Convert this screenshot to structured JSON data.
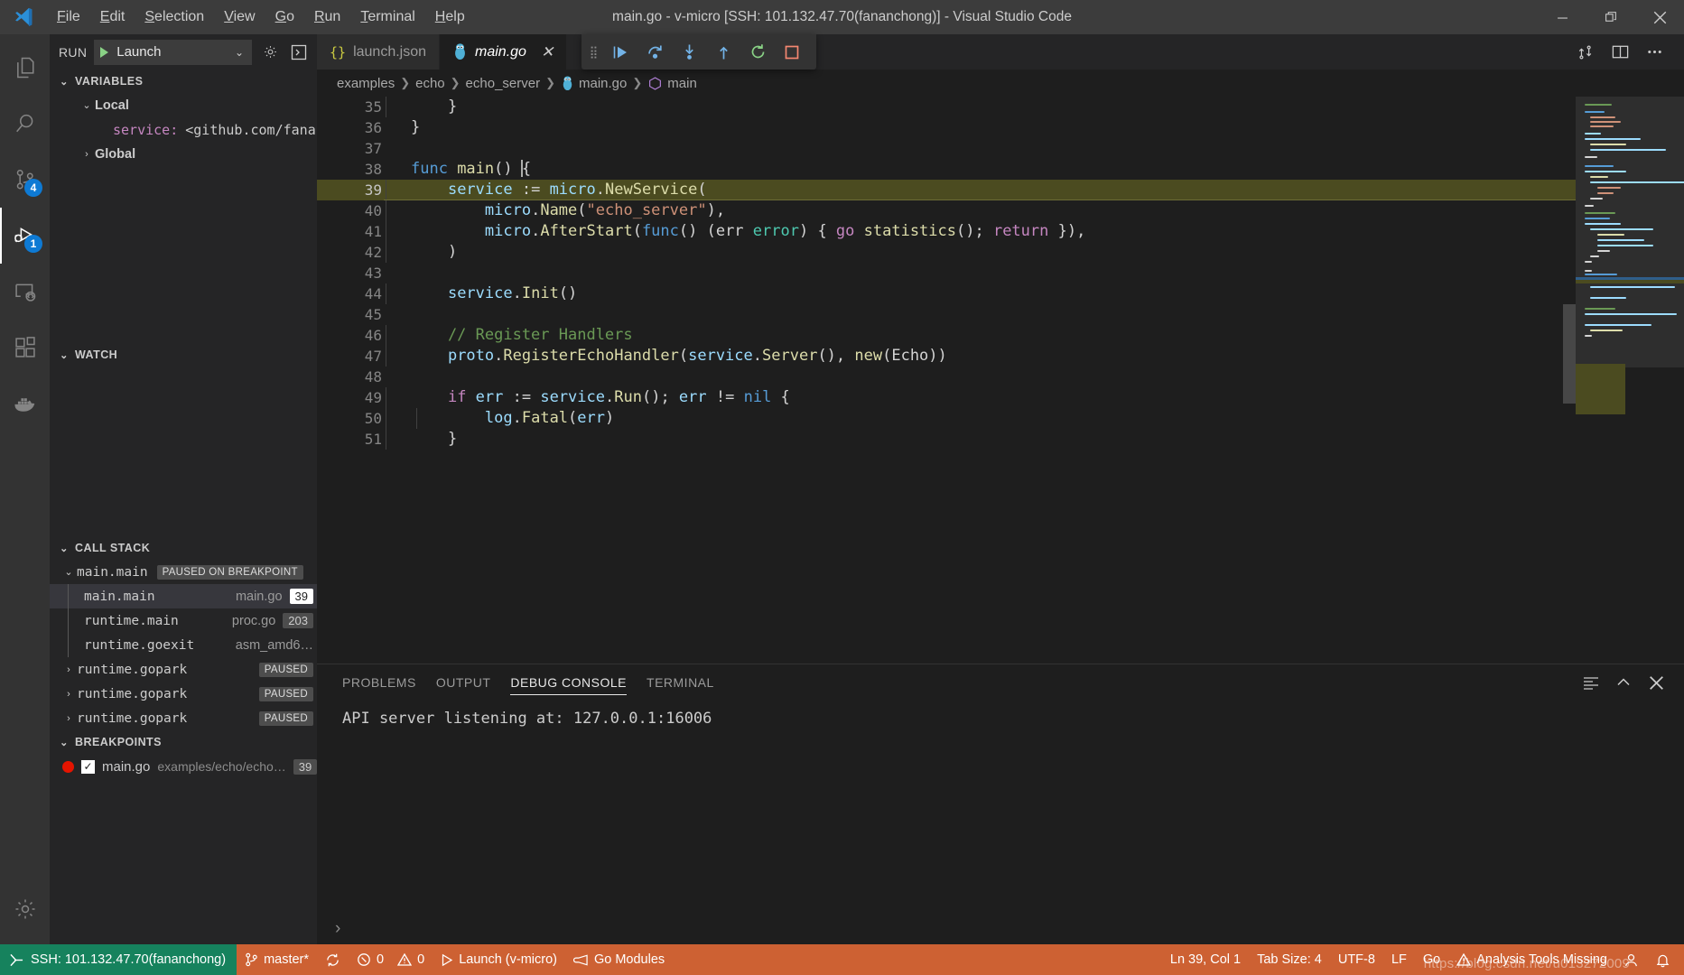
{
  "window": {
    "title": "main.go - v-micro [SSH: 101.132.47.70(fananchong)] - Visual Studio Code",
    "minimize_label": "Minimize",
    "restore_label": "Restore",
    "close_label": "Close"
  },
  "menubar": {
    "items": [
      {
        "label": "File"
      },
      {
        "label": "Edit"
      },
      {
        "label": "Selection"
      },
      {
        "label": "View"
      },
      {
        "label": "Go"
      },
      {
        "label": "Run"
      },
      {
        "label": "Terminal"
      },
      {
        "label": "Help"
      }
    ]
  },
  "activitybar": {
    "items": [
      {
        "name": "explorer",
        "icon": "files-icon",
        "badge": ""
      },
      {
        "name": "search",
        "icon": "search-icon",
        "badge": ""
      },
      {
        "name": "source-control",
        "icon": "source-control-icon",
        "badge": "4"
      },
      {
        "name": "run-and-debug",
        "icon": "run-debug-icon",
        "badge": "1",
        "active": true
      },
      {
        "name": "remote-explorer",
        "icon": "remote-explorer-icon",
        "badge": ""
      },
      {
        "name": "extensions",
        "icon": "extensions-icon",
        "badge": ""
      },
      {
        "name": "docker",
        "icon": "docker-icon",
        "badge": ""
      }
    ],
    "bottom": [
      {
        "name": "manage",
        "icon": "gear-icon"
      }
    ]
  },
  "sidebar": {
    "run_label": "RUN",
    "launch_config": "Launch",
    "settings_icon_label": "Open launch.json",
    "open_debug_console_label": "Debug Console",
    "variables": {
      "header": "VARIABLES",
      "rows": [
        {
          "indent": 0,
          "twisty": "down",
          "label": "Local",
          "bold": true
        },
        {
          "indent": 1,
          "twisty": "none",
          "name": "service:",
          "value": "<github.com/fananc…",
          "mono": true
        },
        {
          "indent": 0,
          "twisty": "right",
          "label": "Global",
          "bold": true
        }
      ]
    },
    "watch": {
      "header": "WATCH",
      "rows": []
    },
    "callstack": {
      "header": "CALL STACK",
      "threads": [
        {
          "name": "main.main",
          "badge": "PAUSED ON BREAKPOINT",
          "expanded": true,
          "frames": [
            {
              "name": "main.main",
              "file": "main.go",
              "line": "39",
              "selected": true
            },
            {
              "name": "runtime.main",
              "file": "proc.go",
              "line": "203",
              "selected": false
            },
            {
              "name": "runtime.goexit",
              "file": "asm_amd6…",
              "line": "",
              "selected": false
            }
          ]
        },
        {
          "name": "runtime.gopark",
          "badge": "PAUSED",
          "expanded": false,
          "frames": []
        },
        {
          "name": "runtime.gopark",
          "badge": "PAUSED",
          "expanded": false,
          "frames": []
        },
        {
          "name": "runtime.gopark",
          "badge": "PAUSED",
          "expanded": false,
          "frames": []
        }
      ]
    },
    "breakpoints": {
      "header": "BREAKPOINTS",
      "rows": [
        {
          "file": "main.go",
          "path": "examples/echo/echo…",
          "line": "39",
          "enabled": true
        }
      ]
    }
  },
  "editor": {
    "tabs": [
      {
        "label": "launch.json",
        "icon": "json-icon",
        "active": false,
        "closable": false
      },
      {
        "label": "main.go",
        "icon": "go-gopher-icon",
        "active": true,
        "closable": true,
        "close_label": "×"
      }
    ],
    "actions": [
      {
        "name": "run-or-debug",
        "icon": "split-source-control-icon"
      },
      {
        "name": "split-editor",
        "icon": "split-editor-icon"
      },
      {
        "name": "more-actions",
        "icon": "ellipsis-icon"
      }
    ],
    "debug_toolbar": [
      {
        "name": "continue",
        "icon": "continue-icon"
      },
      {
        "name": "step-over",
        "icon": "step-over-icon"
      },
      {
        "name": "step-into",
        "icon": "step-into-icon"
      },
      {
        "name": "step-out",
        "icon": "step-out-icon"
      },
      {
        "name": "restart",
        "icon": "restart-icon"
      },
      {
        "name": "stop",
        "icon": "stop-icon"
      }
    ],
    "breadcrumbs": [
      {
        "label": "examples",
        "icon": ""
      },
      {
        "label": "echo",
        "icon": ""
      },
      {
        "label": "echo_server",
        "icon": ""
      },
      {
        "label": "main.go",
        "icon": "go-gopher-icon"
      },
      {
        "label": "main",
        "icon": "symbol-method-icon"
      }
    ],
    "lines": [
      {
        "no": "35",
        "indent": 1,
        "tokens": [
          {
            "t": "    }",
            "c": "t-punc"
          }
        ]
      },
      {
        "no": "36",
        "indent": 0,
        "tokens": [
          {
            "t": "}",
            "c": "t-punc"
          }
        ]
      },
      {
        "no": "37",
        "indent": 0,
        "tokens": []
      },
      {
        "no": "38",
        "indent": 0,
        "caret": true,
        "tokens": [
          {
            "t": "func ",
            "c": "t-kw"
          },
          {
            "t": "main",
            "c": "t-fn"
          },
          {
            "t": "() ",
            "c": "t-punc"
          },
          {
            "t": "{",
            "c": "t-punc"
          }
        ]
      },
      {
        "no": "39",
        "indent": 1,
        "highlight": true,
        "breakpoint": true,
        "tokens": [
          {
            "t": "    ",
            "c": "t-punc"
          },
          {
            "t": "service",
            "c": "t-var"
          },
          {
            "t": " := ",
            "c": "t-punc"
          },
          {
            "t": "micro",
            "c": "t-var"
          },
          {
            "t": ".",
            "c": "t-punc"
          },
          {
            "t": "NewService",
            "c": "t-fn"
          },
          {
            "t": "(",
            "c": "t-punc"
          }
        ]
      },
      {
        "no": "40",
        "indent": 2,
        "tokens": [
          {
            "t": "        ",
            "c": "t-punc"
          },
          {
            "t": "micro",
            "c": "t-var"
          },
          {
            "t": ".",
            "c": "t-punc"
          },
          {
            "t": "Name",
            "c": "t-fn"
          },
          {
            "t": "(",
            "c": "t-punc"
          },
          {
            "t": "\"echo_server\"",
            "c": "t-str"
          },
          {
            "t": "),",
            "c": "t-punc"
          }
        ]
      },
      {
        "no": "41",
        "indent": 2,
        "tokens": [
          {
            "t": "        ",
            "c": "t-punc"
          },
          {
            "t": "micro",
            "c": "t-var"
          },
          {
            "t": ".",
            "c": "t-punc"
          },
          {
            "t": "AfterStart",
            "c": "t-fn"
          },
          {
            "t": "(",
            "c": "t-punc"
          },
          {
            "t": "func",
            "c": "t-kw"
          },
          {
            "t": "() (",
            "c": "t-punc"
          },
          {
            "t": "err ",
            "c": "t-punc"
          },
          {
            "t": "error",
            "c": "t-type"
          },
          {
            "t": ") { ",
            "c": "t-punc"
          },
          {
            "t": "go ",
            "c": "t-kw2"
          },
          {
            "t": "statistics",
            "c": "t-fn"
          },
          {
            "t": "(); ",
            "c": "t-punc"
          },
          {
            "t": "return ",
            "c": "t-kw2"
          },
          {
            "t": "}),",
            "c": "t-punc"
          }
        ]
      },
      {
        "no": "42",
        "indent": 1,
        "tokens": [
          {
            "t": "    )",
            "c": "t-punc"
          }
        ]
      },
      {
        "no": "43",
        "indent": 1,
        "tokens": []
      },
      {
        "no": "44",
        "indent": 1,
        "tokens": [
          {
            "t": "    ",
            "c": "t-punc"
          },
          {
            "t": "service",
            "c": "t-var"
          },
          {
            "t": ".",
            "c": "t-punc"
          },
          {
            "t": "Init",
            "c": "t-fn"
          },
          {
            "t": "()",
            "c": "t-punc"
          }
        ]
      },
      {
        "no": "45",
        "indent": 1,
        "tokens": []
      },
      {
        "no": "46",
        "indent": 1,
        "tokens": [
          {
            "t": "    // Register Handlers",
            "c": "t-cmt"
          }
        ]
      },
      {
        "no": "47",
        "indent": 1,
        "tokens": [
          {
            "t": "    ",
            "c": "t-punc"
          },
          {
            "t": "proto",
            "c": "t-var"
          },
          {
            "t": ".",
            "c": "t-punc"
          },
          {
            "t": "RegisterEchoHandler",
            "c": "t-fn"
          },
          {
            "t": "(",
            "c": "t-punc"
          },
          {
            "t": "service",
            "c": "t-var"
          },
          {
            "t": ".",
            "c": "t-punc"
          },
          {
            "t": "Server",
            "c": "t-fn"
          },
          {
            "t": "(), ",
            "c": "t-punc"
          },
          {
            "t": "new",
            "c": "t-fn"
          },
          {
            "t": "(",
            "c": "t-punc"
          },
          {
            "t": "Echo",
            "c": "t-punc"
          },
          {
            "t": "))",
            "c": "t-punc"
          }
        ]
      },
      {
        "no": "48",
        "indent": 1,
        "tokens": []
      },
      {
        "no": "49",
        "indent": 1,
        "tokens": [
          {
            "t": "    ",
            "c": "t-punc"
          },
          {
            "t": "if ",
            "c": "t-kw2"
          },
          {
            "t": "err",
            "c": "t-var"
          },
          {
            "t": " := ",
            "c": "t-punc"
          },
          {
            "t": "service",
            "c": "t-var"
          },
          {
            "t": ".",
            "c": "t-punc"
          },
          {
            "t": "Run",
            "c": "t-fn"
          },
          {
            "t": "(); ",
            "c": "t-punc"
          },
          {
            "t": "err",
            "c": "t-var"
          },
          {
            "t": " != ",
            "c": "t-punc"
          },
          {
            "t": "nil",
            "c": "t-kw"
          },
          {
            "t": " {",
            "c": "t-punc"
          }
        ]
      },
      {
        "no": "50",
        "indent": 2,
        "tokens": [
          {
            "t": "        ",
            "c": "t-punc"
          },
          {
            "t": "log",
            "c": "t-var"
          },
          {
            "t": ".",
            "c": "t-punc"
          },
          {
            "t": "Fatal",
            "c": "t-fn"
          },
          {
            "t": "(",
            "c": "t-punc"
          },
          {
            "t": "err",
            "c": "t-var"
          },
          {
            "t": ")",
            "c": "t-punc"
          }
        ]
      },
      {
        "no": "51",
        "indent": 1,
        "tokens": [
          {
            "t": "    }",
            "c": "t-punc"
          }
        ]
      }
    ]
  },
  "panel": {
    "tabs": [
      {
        "label": "PROBLEMS",
        "active": false
      },
      {
        "label": "OUTPUT",
        "active": false
      },
      {
        "label": "DEBUG CONSOLE",
        "active": true
      },
      {
        "label": "TERMINAL",
        "active": false
      }
    ],
    "actions": [
      {
        "name": "clear-console",
        "icon": "clear-console-icon"
      },
      {
        "name": "maximize-panel",
        "icon": "chevron-up-icon"
      },
      {
        "name": "close-panel",
        "icon": "close-icon"
      }
    ],
    "console_lines": [
      "API server listening at: 127.0.0.1:16006"
    ],
    "console_prompt": "›"
  },
  "statusbar": {
    "remote": "SSH: 101.132.47.70(fananchong)",
    "branch": "master*",
    "sync_icon": "sync-icon",
    "errors": "0",
    "warnings": "0",
    "launch": "Launch (v-micro)",
    "go_modules": "Go Modules",
    "position": "Ln 39, Col 1",
    "tab_size": "Tab Size: 4",
    "encoding": "UTF-8",
    "eol": "LF",
    "language": "Go",
    "analysis": "Analysis Tools Missing",
    "account_icon": "account-icon",
    "bell_icon": "bell-icon",
    "watermark": "https://blog.csdn.net/u013272009"
  },
  "colors": {
    "statusbar_bg": "#cd6133",
    "remote_bg": "#16825d",
    "accent_blue": "#0e7ad4",
    "breakpoint_red": "#e51400",
    "highlight_line": "#4b4b20"
  }
}
